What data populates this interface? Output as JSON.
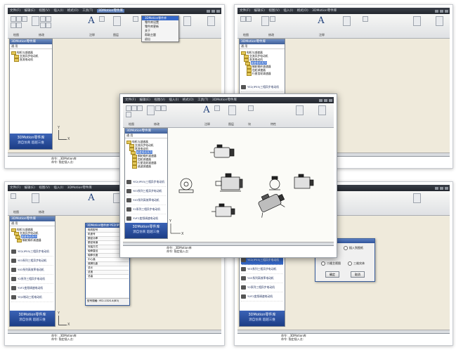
{
  "window": {
    "title": "3D Motion 零件库",
    "menu": [
      "文件(F)",
      "编辑(E)",
      "视图(V)",
      "插入(I)",
      "格式(O)",
      "工具(T)",
      "绘图(D)",
      "标注(N)",
      "修改(M)",
      "参数(P)",
      "窗口(W)",
      "帮助(H)"
    ],
    "active_menu": "3DMotion零件库"
  },
  "panel": {
    "title": "3DMotion零件库",
    "tabs": "通  用",
    "tree": [
      "电机与减速器",
      "交流异步电动机",
      "直流电动机",
      "减速电机系列",
      "蜗轮蜗杆减速器",
      "齿轮减速器",
      "行星齿轮减速器",
      "谐波减速器"
    ],
    "parts": [
      "YE2(IP55)三相异步电动机",
      "YE3系列三相异步电动机",
      "YX3系列高效率电动机",
      "Y2系列三相异步电动机",
      "YVF2变频调速电动机",
      "YEJ2制动三相电动机"
    ]
  },
  "logo": {
    "line1": "3DMotion零件库",
    "line2": "源自仿真  超越三维"
  },
  "command": {
    "line1": "命令: _3DMotion库",
    "line2": "命令: 指定插入点:"
  },
  "ribbon": {
    "labels": [
      "绘图",
      "修改",
      "注释",
      "图层",
      "块",
      "特性",
      "实用工具",
      "剪贴板"
    ]
  },
  "menu_popup": {
    "items": [
      "3DMotion零件库",
      "零件库设置",
      "零件库更新",
      "关于",
      "帮助主题",
      "退出"
    ]
  },
  "dialog_params": {
    "title": "3DMotion零件库-YE2(IP55)三相异步电动机",
    "rows": [
      "电机型号",
      "机座号",
      "额定功率",
      "额定转速",
      "安装方式",
      "轴伸直径",
      "轴伸长度",
      "中心高",
      "底脚孔距",
      "总长",
      "总宽",
      "总高"
    ],
    "footer": "型号规格: YE2-132S-4(B3)"
  },
  "dialog_insert": {
    "title": "插入方式",
    "options": [
      "插入到图纸",
      "二维主视图",
      "三维实体"
    ],
    "group": "视图方向",
    "ok": "确定",
    "cancel": "取消"
  },
  "axes": {
    "y": "Y",
    "x": "X"
  },
  "colors": {
    "titlebar": "#2a2f37",
    "ribbon": "#e4e6e9",
    "canvas": "#efeadb",
    "panel_title": "#4f6fae",
    "logo": "#2a4e9c",
    "selection": "#3568c9"
  }
}
